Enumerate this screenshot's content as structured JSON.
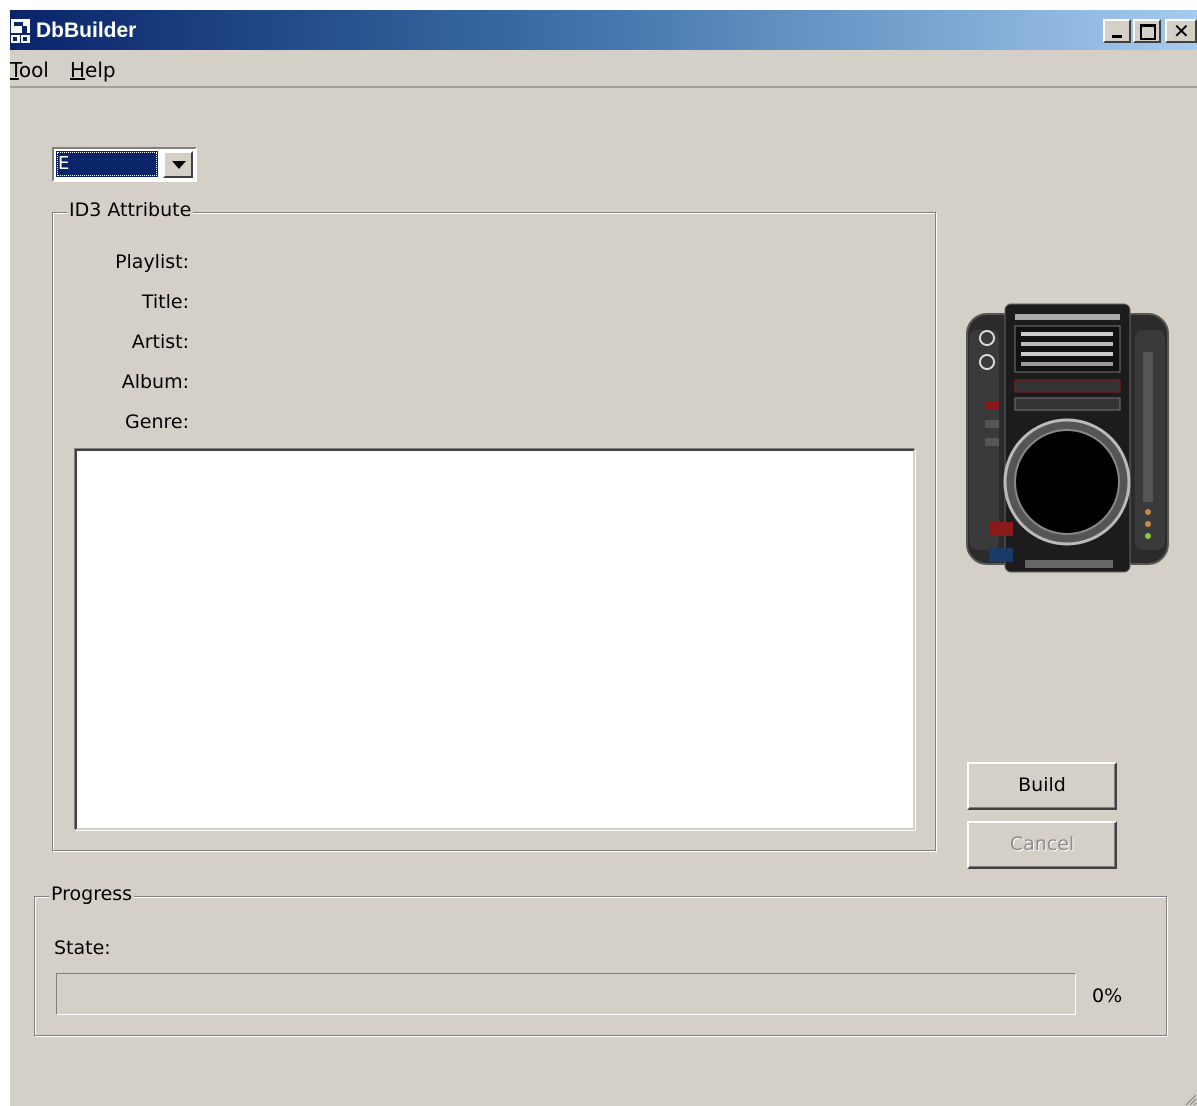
{
  "window": {
    "title": "DbBuilder",
    "icon": "dbbuilder-app-icon",
    "controls": [
      "minimize-icon",
      "maximize-icon",
      "close-icon"
    ],
    "close_glyph": "✕"
  },
  "menu": {
    "tool": "Tool",
    "tool_mnemonic": "T",
    "tool_rest": "ool",
    "help": "Help",
    "help_mnemonic": "H",
    "help_rest": "elp"
  },
  "drive_select": {
    "value": "E"
  },
  "id3": {
    "group_title": "ID3 Attribute",
    "labels": {
      "playlist": "Playlist:",
      "title": "Title:",
      "artist": "Artist:",
      "album": "Album:",
      "genre": "Genre:"
    },
    "list_items": []
  },
  "buttons": {
    "build": "Build",
    "cancel": "Cancel",
    "cancel_enabled": false
  },
  "progress": {
    "group_title": "Progress",
    "state_label": "State:",
    "state_value": "",
    "percent_text": "0%",
    "fraction": 0
  },
  "colors": {
    "titlebar_start": "#0a246a",
    "titlebar_end": "#a6caf0",
    "face": "#d4d0c8",
    "selection": "#0a246a"
  }
}
